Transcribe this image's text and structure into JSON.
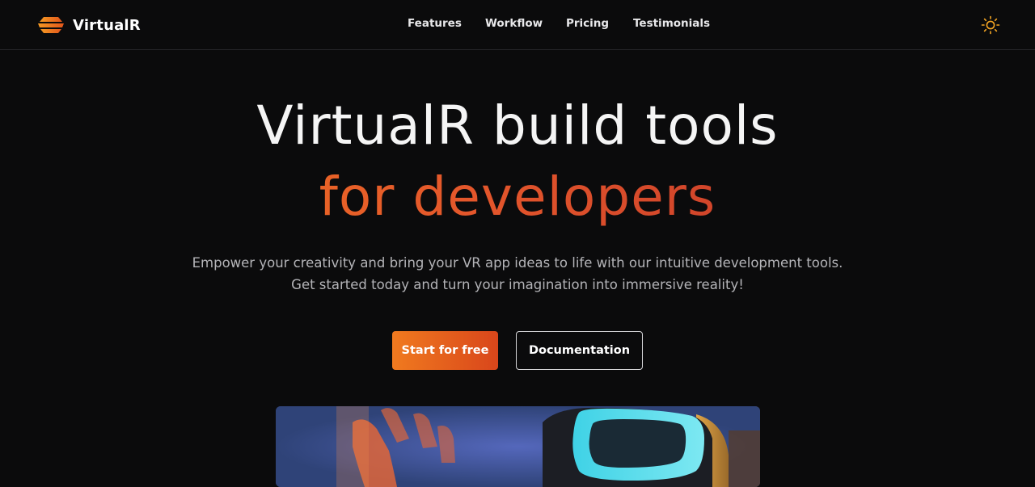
{
  "brand": {
    "name": "VirtualR",
    "logo_icon": "stacked-layers-logo-icon",
    "accent": "#f27a1e"
  },
  "nav": {
    "items": [
      {
        "label": "Features"
      },
      {
        "label": "Workflow"
      },
      {
        "label": "Pricing"
      },
      {
        "label": "Testimonials"
      }
    ],
    "theme_toggle_icon": "sun-icon"
  },
  "hero": {
    "title_line1": "VirtualR build tools",
    "title_line2": "for developers",
    "subtitle_line1": "Empower your creativity and bring your VR app ideas to life with our intuitive development tools.",
    "subtitle_line2": "Get started today and turn your imagination into immersive reality!",
    "primary_cta": "Start for free",
    "secondary_cta": "Documentation",
    "media_image": "vr-headset-photo"
  },
  "colors": {
    "background": "#0b0b0c",
    "gradient_start": "#f27a1e",
    "gradient_end": "#b92e2a",
    "sun_icon": "#f5a623"
  }
}
